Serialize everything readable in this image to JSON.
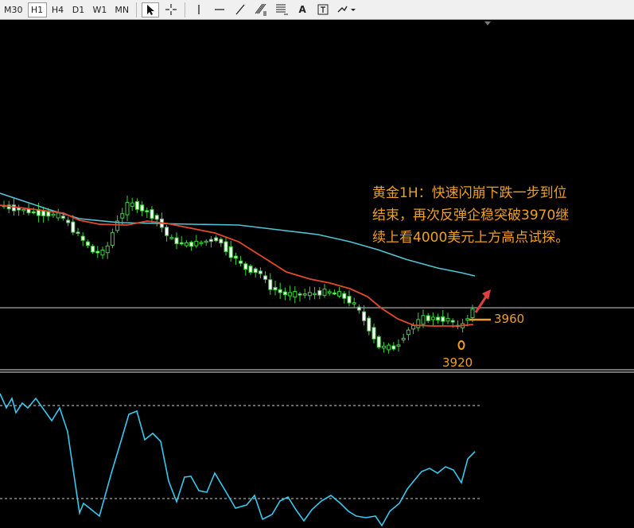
{
  "toolbar": {
    "timeframes": [
      "M30",
      "H1",
      "H4",
      "D1",
      "W1",
      "MN"
    ],
    "active_timeframe": "H1",
    "tools": [
      "cursor-icon",
      "crosshair-icon",
      "vertical-line-icon",
      "horizontal-line-icon",
      "trendline-icon",
      "fibonacci-icon",
      "fibo-fan-icon",
      "text-icon",
      "text-label-icon",
      "arrows-icon"
    ],
    "tool_labels": {
      "text": "A"
    }
  },
  "annotation": {
    "lines": [
      "黄金1H：快速闪崩下跌一步到位",
      "结束，再次反弹企稳突破3970继",
      "续上看4000美元上方高点试探。"
    ]
  },
  "chart_data": {
    "type": "candlestick",
    "price_labels": [
      "3960",
      "3920"
    ],
    "indicator_type": "line"
  },
  "colors": {
    "bull": "#3cd23c",
    "bear": "#ffffff",
    "ma_fast": "#e24a2a",
    "ma_slow": "#52c4d6",
    "annotation": "#f0a020",
    "arrow": "#e04040",
    "oscillator": "#38c8f0"
  }
}
